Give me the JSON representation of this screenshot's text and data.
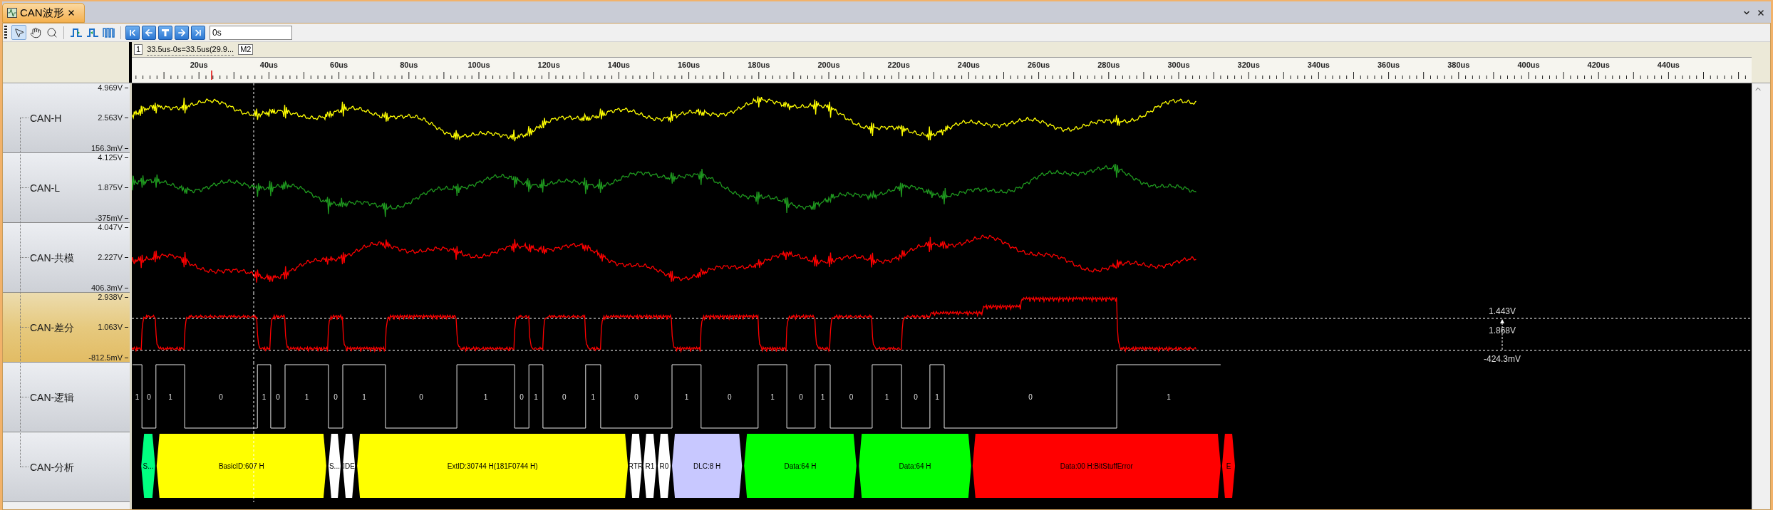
{
  "tab": {
    "title": "CAN波形",
    "selected": true
  },
  "toolbar": {
    "tools": [
      {
        "kind": "pointer",
        "selected": true
      },
      {
        "kind": "hand",
        "selected": false
      },
      {
        "kind": "zoom",
        "selected": false
      }
    ],
    "time_field": {
      "value": "0s"
    }
  },
  "marker_bar": {
    "left_marker": "1",
    "measurement": "33.5us-0s=33.5us(29.9...",
    "right_marker": "M2"
  },
  "ruler": {
    "labels": [
      "20us",
      "40us",
      "60us",
      "80us",
      "100us",
      "120us",
      "140us",
      "160us",
      "180us",
      "200us",
      "220us",
      "240us",
      "260us",
      "280us",
      "300us",
      "320us",
      "340us",
      "360us",
      "380us",
      "400us",
      "420us",
      "440us"
    ]
  },
  "channels": [
    {
      "name": "CAN-H",
      "kind": "analog",
      "selected": false,
      "color": "#ffff00",
      "scale": [
        "4.969V",
        "2.563V",
        "156.3mV"
      ]
    },
    {
      "name": "CAN-L",
      "kind": "analog",
      "selected": false,
      "color": "#1f9a1f",
      "scale": [
        "4.125V",
        "1.875V",
        "-375mV"
      ]
    },
    {
      "name": "CAN-共模",
      "kind": "analog",
      "selected": false,
      "color": "#ff0000",
      "scale": [
        "4.047V",
        "2.227V",
        "406.3mV"
      ]
    },
    {
      "name": "CAN-差分",
      "kind": "differential",
      "selected": true,
      "color": "#ff0000",
      "scale": [
        "2.938V",
        "1.063V",
        "-812.5mV"
      ],
      "readings": [
        "1.443V",
        "1.868V",
        "-424.3mV"
      ]
    },
    {
      "name": "CAN-逻辑",
      "kind": "logic",
      "selected": false,
      "bits": [
        "1",
        "0",
        "1",
        "0",
        "1",
        "0",
        "1",
        "0",
        "1",
        "0",
        "1",
        "0",
        "1",
        "0",
        "1",
        "0",
        "1",
        "0",
        "1",
        "0",
        "1",
        "0",
        "1",
        "0",
        "1",
        "0",
        "1"
      ]
    },
    {
      "name": "CAN-分析",
      "kind": "decode",
      "selected": false,
      "fields": [
        {
          "label": "S...",
          "color": "#00ff80"
        },
        {
          "label": "BasicID:607 H",
          "color": "#ffff00"
        },
        {
          "label": "S...",
          "color": "#ffffff"
        },
        {
          "label": "IDE",
          "color": "#ffffff"
        },
        {
          "label": "ExtID:30744 H(181F0744 H)",
          "color": "#ffff00"
        },
        {
          "label": "RTR",
          "color": "#ffffff"
        },
        {
          "label": "R1",
          "color": "#ffffff"
        },
        {
          "label": "R0",
          "color": "#ffffff"
        },
        {
          "label": "DLC:8 H",
          "color": "#c8c8ff"
        },
        {
          "label": "Data:64 H",
          "color": "#00ff00"
        },
        {
          "label": "Data:64 H",
          "color": "#00ff00"
        },
        {
          "label": "Data:00 H:BitStuffError",
          "color": "#ff0000"
        },
        {
          "label": "E",
          "color": "#ff0000"
        }
      ]
    }
  ]
}
